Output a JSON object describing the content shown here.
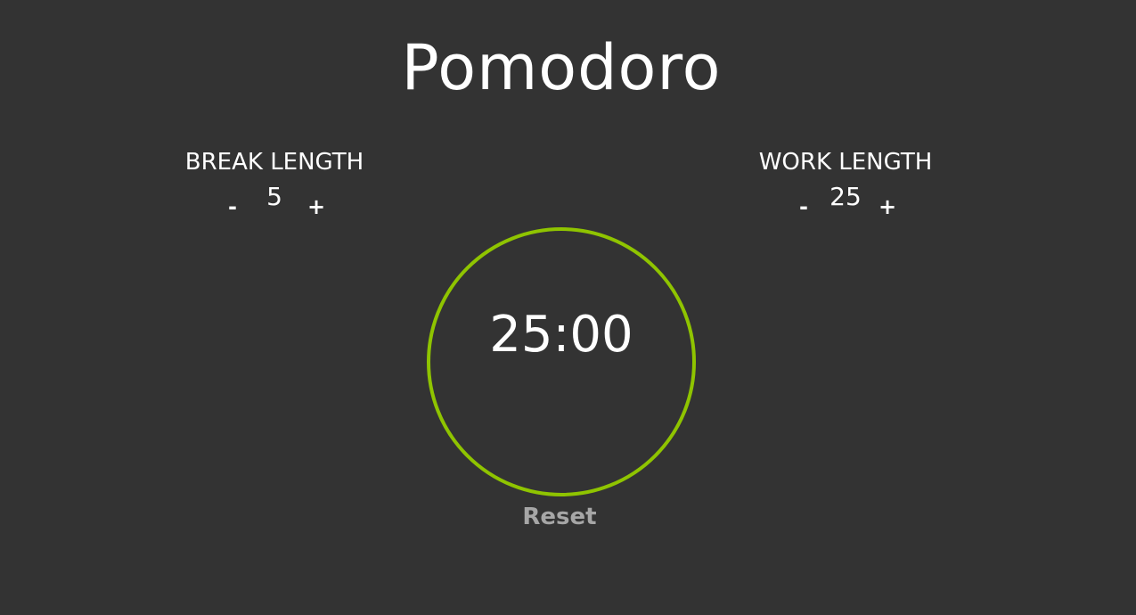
{
  "app": {
    "title": "Pomodoro"
  },
  "break_setting": {
    "label": "BREAK LENGTH",
    "decrement_label": "-",
    "value": "5",
    "increment_label": "+"
  },
  "work_setting": {
    "label": "WORK LENGTH",
    "decrement_label": "-",
    "value": "25",
    "increment_label": "+"
  },
  "timer": {
    "display": "25:00"
  },
  "actions": {
    "reset_label": "Reset"
  },
  "colors": {
    "background": "#333333",
    "text": "#ffffff",
    "ring": "#8fc400",
    "reset": "#a6a6a6"
  }
}
